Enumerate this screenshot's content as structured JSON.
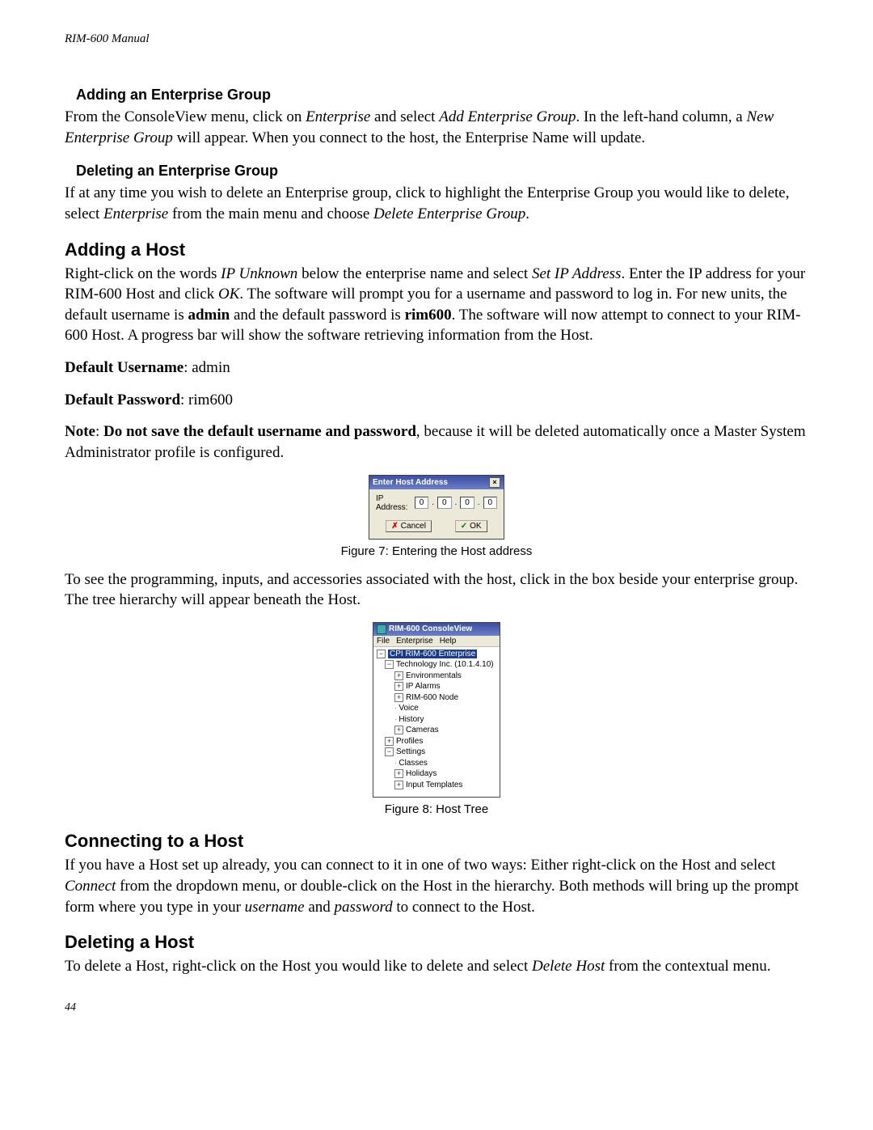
{
  "header": "RIM-600  Manual",
  "page_number": "44",
  "s1": {
    "h": "Adding an Enterprise Group",
    "p_a": "From the ConsoleView menu, click on ",
    "p_b": "Enterprise",
    "p_c": " and select ",
    "p_d": "Add Enterprise Group",
    "p_e": ". In the left-hand column, a ",
    "p_f": "New Enterprise Group",
    "p_g": " will appear. When you connect to the host, the Enterprise Name will update."
  },
  "s2": {
    "h": "Deleting an Enterprise Group",
    "p_a": "If at any time you wish to delete an Enterprise group, click to highlight the Enterprise Group you would like to delete, select ",
    "p_b": "Enterprise",
    "p_c": " from the main menu and choose ",
    "p_d": "Delete Enterprise Group",
    "p_e": "."
  },
  "s3": {
    "h": "Adding a Host",
    "p_a": "Right-click on the words ",
    "p_b": "IP Unknown",
    "p_c": " below the enterprise name and select ",
    "p_d": "Set IP Address",
    "p_e": ". Enter the IP address for your RIM-600 Host and click ",
    "p_f": "OK",
    "p_g": ". The software will prompt you for a username and password to log in. For new units, the default username is ",
    "p_h": "admin",
    "p_i": " and the default password is ",
    "p_j": "rim600",
    "p_k": ". The software will now attempt to connect to your RIM-600 Host. A progress bar will show the software retrieving information from the Host.",
    "du_label": "Default Username",
    "du_value": ": admin",
    "dp_label": "Default Password",
    "dp_value": ": rim600",
    "note_a": "Note",
    "note_b": ": ",
    "note_c": "Do not save the default username and password",
    "note_d": ", because it will be deleted automatically once a Master System Administrator profile is configured."
  },
  "fig7": {
    "title": "Enter Host Address",
    "ip_label": "IP Address:",
    "ip1": "0",
    "ip2": "0",
    "ip3": "0",
    "ip4": "0",
    "cancel": "Cancel",
    "ok": "OK",
    "caption": "Figure 7: Entering the Host address"
  },
  "after7": "To see the programming, inputs, and accessories associated with the host, click in the box beside your enterprise group.  The tree hierarchy will appear beneath the Host.",
  "fig8": {
    "title": "RIM-600 ConsoleView",
    "menu_file": "File",
    "menu_enterprise": "Enterprise",
    "menu_help": "Help",
    "n_root": "CPI RIM-600 Enterprise",
    "n_host": "Technology Inc. (10.1.4.10)",
    "n_env": "Environmentals",
    "n_ipa": "IP Alarms",
    "n_node": "RIM-600 Node",
    "n_voice": "Voice",
    "n_history": "History",
    "n_cameras": "Cameras",
    "n_profiles": "Profiles",
    "n_settings": "Settings",
    "n_classes": "Classes",
    "n_holidays": "Holidays",
    "n_input": "Input Templates",
    "caption": "Figure 8: Host Tree"
  },
  "s4": {
    "h": "Connecting to a Host",
    "p_a": "If you have a Host set up already, you can connect to it in one of two ways: Either right-click on the Host and select ",
    "p_b": "Connect",
    "p_c": " from the dropdown menu, or double-click on the Host in the hierarchy. Both methods will bring up the prompt form where you type in your ",
    "p_d": "username",
    "p_e": " and ",
    "p_f": "password",
    "p_g": " to connect to the Host."
  },
  "s5": {
    "h": "Deleting a Host",
    "p_a": "To delete a Host, right-click on the Host you would like to delete and select ",
    "p_b": "Delete Host",
    "p_c": " from the contextual menu."
  }
}
